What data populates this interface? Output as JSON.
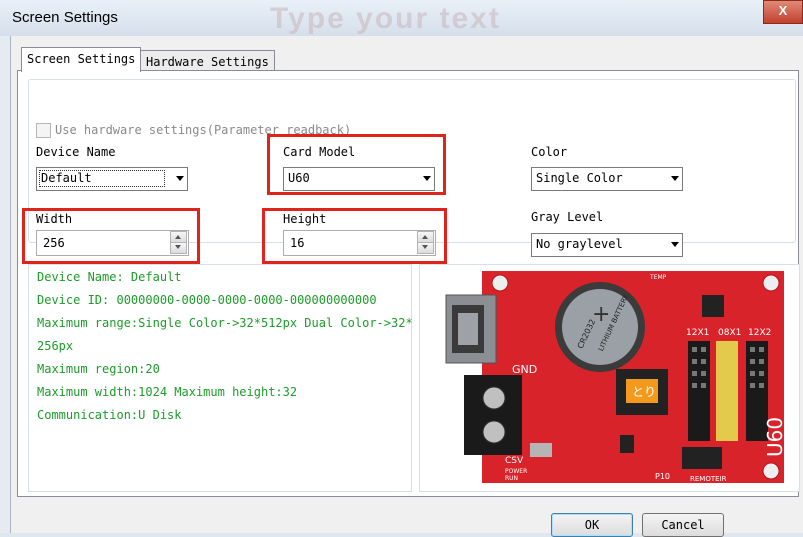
{
  "window": {
    "title": "Screen Settings",
    "watermark": "Type your text",
    "close_label": "X"
  },
  "tabs": [
    {
      "label": "Screen Settings",
      "active": true
    },
    {
      "label": "Hardware Settings",
      "active": false
    }
  ],
  "form": {
    "use_hw_label": "Use hardware settings(Parameter readback)",
    "device_name": {
      "label": "Device Name",
      "value": "Default"
    },
    "card_model": {
      "label": "Card Model",
      "value": "U60"
    },
    "color": {
      "label": "Color",
      "value": "Single Color"
    },
    "width": {
      "label": "Width",
      "value": "256"
    },
    "height": {
      "label": "Height",
      "value": "16"
    },
    "gray_level": {
      "label": "Gray Level",
      "value": "No graylevel"
    }
  },
  "info": {
    "device_name": "Device Name: Default",
    "device_id": "Device ID:  00000000-0000-0000-0000-000000000000",
    "max_range_1": "Maximum range:Single Color->32*512px  Dual Color->32*",
    "max_range_2": "256px",
    "max_region": "Maximum region:20",
    "max_wh": "Maximum width:1024 Maximum height:32",
    "communication": "Communication:U Disk"
  },
  "board": {
    "gnd": "GND",
    "csv": "CSV",
    "power": "POWER",
    "run": "RUN",
    "p12x1": "12X1",
    "p08x1": "08X1",
    "p12x2": "12X2",
    "u60": "U60",
    "battery": "CR2032",
    "lithium": "LITHIUM BATTERY",
    "remote": "REMOTEIR",
    "p10": "P10",
    "temp": "TEMP",
    "logo": "とり"
  },
  "buttons": {
    "ok": "OK",
    "cancel": "Cancel"
  },
  "colors": {
    "highlight": "#e0241b",
    "info_text": "#1e9b2a",
    "pcb": "#d8232a"
  }
}
